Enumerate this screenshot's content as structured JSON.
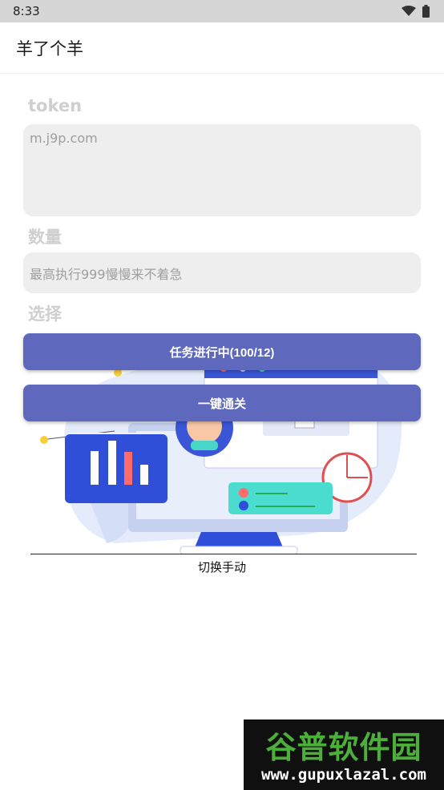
{
  "status_bar": {
    "time": "8:33"
  },
  "app_bar": {
    "title": "羊了个羊"
  },
  "token_section": {
    "label": "token",
    "placeholder": "m.j9p.com"
  },
  "count_section": {
    "label": "数量",
    "placeholder": "最高执行999慢慢来不着急"
  },
  "select_section": {
    "label": "选择"
  },
  "buttons": {
    "task_status": "任务进行中(100/12)",
    "one_key_pass": "一键通关"
  },
  "toggle": {
    "label": "切换手动"
  },
  "watermark": {
    "title": "谷普软件园",
    "url": "www.gupuxlazal.com"
  },
  "colors": {
    "button_bg": "#5e69be",
    "input_bg": "#eeeeee",
    "status_bar": "#d6d6d6"
  }
}
